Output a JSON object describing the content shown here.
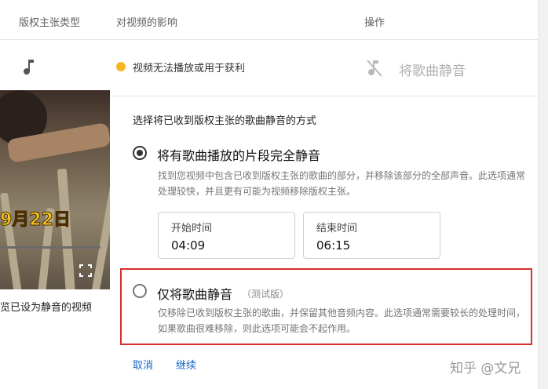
{
  "header": {
    "col_claim_type": "版权主张类型",
    "col_effect": "对视频的影响",
    "col_action": "操作"
  },
  "claim_row": {
    "icon": "music-note-icon",
    "status_color": "#f5b524",
    "effect_text": "视频无法播放或用于获利",
    "action_label": "将歌曲静音",
    "action_icon": "music-off-icon"
  },
  "video_preview": {
    "date_overlay": "9月22日",
    "caption": "览已设为静音的视频",
    "fullscreen_icon": "fullscreen-icon"
  },
  "mute_panel": {
    "heading": "选择将已收到版权主张的歌曲静音的方式",
    "option1": {
      "title": "将有歌曲播放的片段完全静音",
      "description": "找到您视频中包含已收到版权主张的歌曲的部分，并移除该部分的全部声音。此选项通常处理较快，并且更有可能为视频移除版权主张。",
      "selected": true
    },
    "start_time": {
      "label": "开始时间",
      "value": "04:09"
    },
    "end_time": {
      "label": "结束时间",
      "value": "06:15"
    },
    "option2": {
      "title": "仅将歌曲静音",
      "badge": "（测试版）",
      "description": "仅移除已收到版权主张的歌曲，并保留其他音频内容。此选项通常需要较长的处理时间，如果歌曲很难移除，则此选项可能会不起作用。",
      "selected": false
    },
    "cancel_label": "取消",
    "continue_label": "继续"
  },
  "watermark": "知乎 @文兄",
  "colors": {
    "highlight_border": "#d9302c",
    "link": "#1769c8",
    "status_dot": "#f5b524"
  }
}
